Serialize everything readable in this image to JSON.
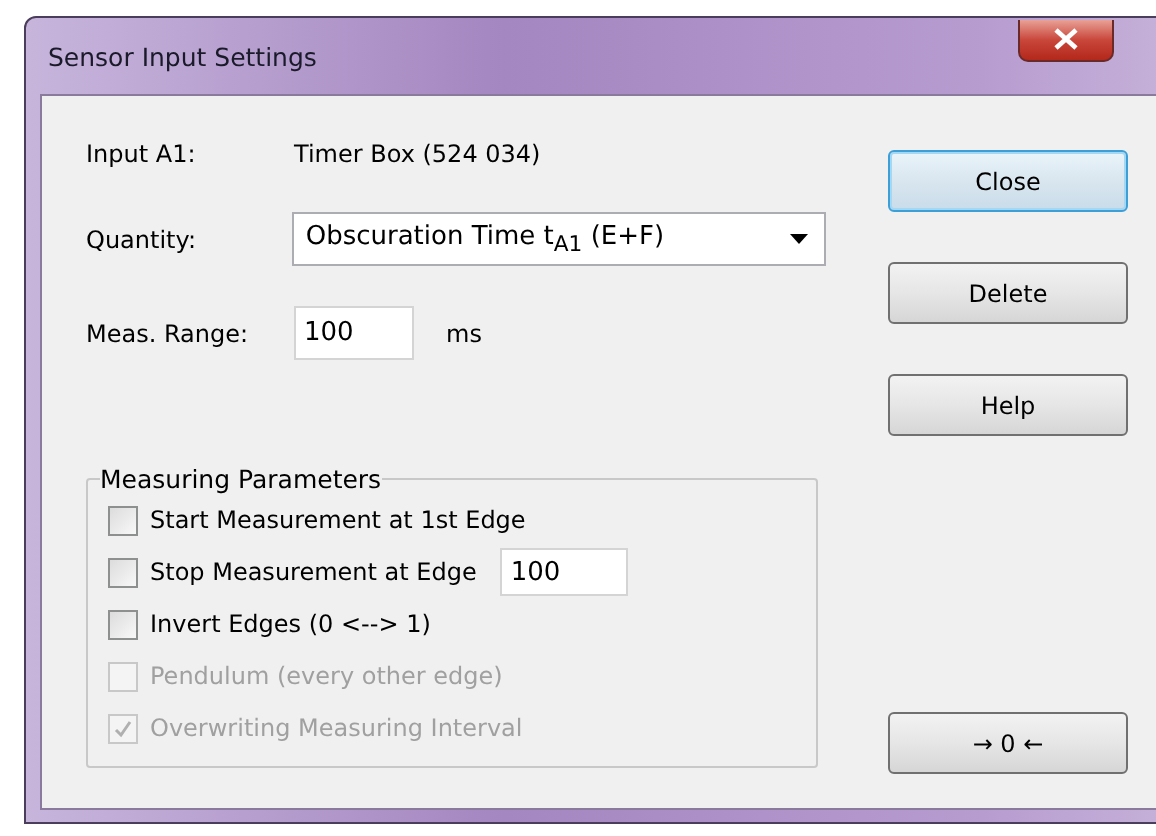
{
  "window": {
    "title": "Sensor Input Settings"
  },
  "input": {
    "label": "Input A1:",
    "value": "Timer Box (524 034)"
  },
  "quantity": {
    "label": "Quantity:",
    "value": "Obscuration Time t$_{A1}$ (E+F)"
  },
  "range": {
    "label": "Meas. Range:",
    "value": "100",
    "unit": "ms"
  },
  "group": {
    "title": "Measuring Parameters",
    "options": [
      {
        "label": "Start Measurement at 1st Edge",
        "checked": false,
        "disabled": false
      },
      {
        "label": "Stop Measurement at Edge",
        "checked": false,
        "disabled": false,
        "value": "100"
      },
      {
        "label": "Invert Edges (0 <--> 1)",
        "checked": false,
        "disabled": false
      },
      {
        "label": "Pendulum (every other edge)",
        "checked": false,
        "disabled": true
      },
      {
        "label": "Overwriting Measuring Interval",
        "checked": true,
        "disabled": true
      }
    ]
  },
  "buttons": [
    {
      "label": "Close",
      "default": true
    },
    {
      "label": "Delete",
      "default": false
    },
    {
      "label": "Help",
      "default": false
    }
  ],
  "zero_button": {
    "label": "→ 0 ←"
  }
}
